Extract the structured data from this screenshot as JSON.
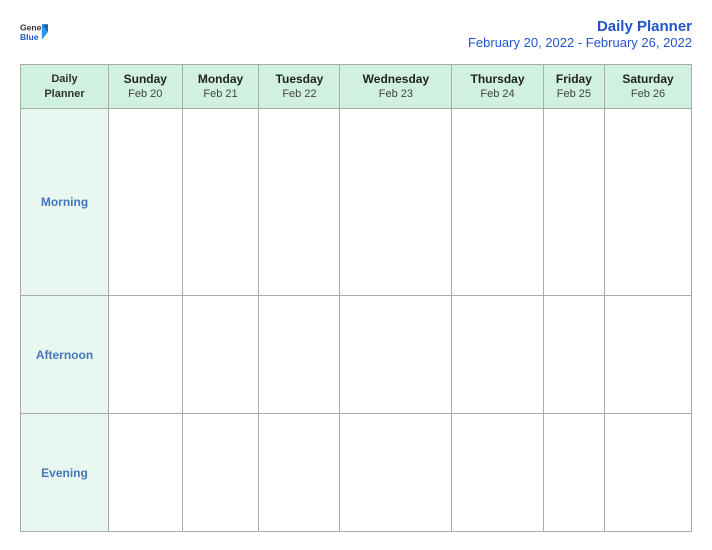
{
  "header": {
    "logo": {
      "general": "General",
      "blue": "Blue"
    },
    "planner_title": "Daily Planner",
    "date_range": "February 20, 2022 - February 26, 2022"
  },
  "table": {
    "header_label_line1": "Daily",
    "header_label_line2": "Planner",
    "columns": [
      {
        "day": "Sunday",
        "date": "Feb 20"
      },
      {
        "day": "Monday",
        "date": "Feb 21"
      },
      {
        "day": "Tuesday",
        "date": "Feb 22"
      },
      {
        "day": "Wednesday",
        "date": "Feb 23"
      },
      {
        "day": "Thursday",
        "date": "Feb 24"
      },
      {
        "day": "Friday",
        "date": "Feb 25"
      },
      {
        "day": "Saturday",
        "date": "Feb 26"
      }
    ],
    "rows": [
      {
        "label": "Morning"
      },
      {
        "label": "Afternoon"
      },
      {
        "label": "Evening"
      }
    ]
  }
}
